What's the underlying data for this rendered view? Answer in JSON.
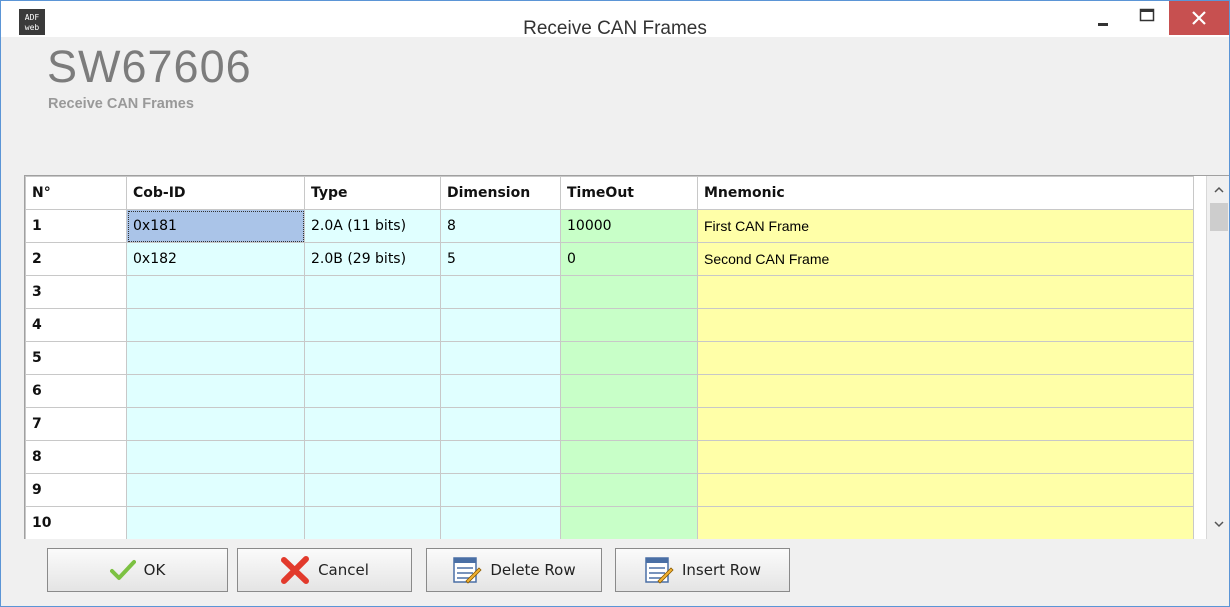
{
  "window": {
    "title": "Receive CAN Frames",
    "app_icon_text_top": "ADF",
    "app_icon_text_bottom": "web",
    "close_symbol": "×",
    "accent_color": "#c75050"
  },
  "header": {
    "product": "SW67606",
    "subtitle": "Receive CAN Frames"
  },
  "table": {
    "columns": [
      "N°",
      "Cob-ID",
      "Type",
      "Dimension",
      "TimeOut",
      "Mnemonic"
    ],
    "rows": [
      {
        "num": "1",
        "cob": "0x181",
        "type": "2.0A (11 bits)",
        "dim": "8",
        "timeout": "10000",
        "mnemonic": "First CAN Frame"
      },
      {
        "num": "2",
        "cob": "0x182",
        "type": "2.0B (29 bits)",
        "dim": "5",
        "timeout": "0",
        "mnemonic": "Second CAN Frame"
      },
      {
        "num": "3",
        "cob": "",
        "type": "",
        "dim": "",
        "timeout": "",
        "mnemonic": ""
      },
      {
        "num": "4",
        "cob": "",
        "type": "",
        "dim": "",
        "timeout": "",
        "mnemonic": ""
      },
      {
        "num": "5",
        "cob": "",
        "type": "",
        "dim": "",
        "timeout": "",
        "mnemonic": ""
      },
      {
        "num": "6",
        "cob": "",
        "type": "",
        "dim": "",
        "timeout": "",
        "mnemonic": ""
      },
      {
        "num": "7",
        "cob": "",
        "type": "",
        "dim": "",
        "timeout": "",
        "mnemonic": ""
      },
      {
        "num": "8",
        "cob": "",
        "type": "",
        "dim": "",
        "timeout": "",
        "mnemonic": ""
      },
      {
        "num": "9",
        "cob": "",
        "type": "",
        "dim": "",
        "timeout": "",
        "mnemonic": ""
      },
      {
        "num": "10",
        "cob": "",
        "type": "",
        "dim": "",
        "timeout": "",
        "mnemonic": ""
      }
    ],
    "column_colors": {
      "cob_type_dim": "#e0ffff",
      "timeout": "#c8ffc8",
      "mnemonic": "#ffffa8"
    }
  },
  "buttons": {
    "ok": "OK",
    "cancel": "Cancel",
    "delete_row": "Delete Row",
    "insert_row": "Insert Row"
  },
  "icons": {
    "ok": "check-icon",
    "cancel": "red-x-icon",
    "delete_row": "delete-row-icon",
    "insert_row": "insert-row-icon",
    "scroll_up": "chevron-up-icon",
    "scroll_down": "chevron-down-icon"
  }
}
